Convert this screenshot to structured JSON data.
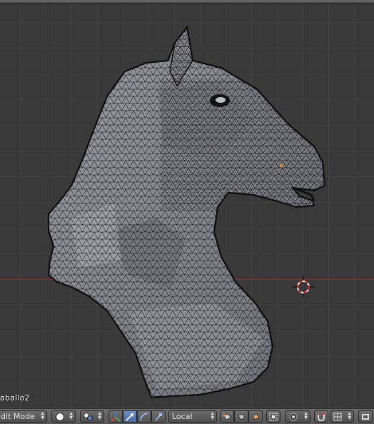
{
  "viewport": {
    "object_name": "aballo2",
    "axis_color": "#8c2a2a",
    "background_color": "#393939"
  },
  "header": {
    "mode_label": "dit Mode",
    "viewport_shading_icon": "solid-sphere-icon",
    "pivot_icon": "pivot-point-icon",
    "manipulator_icons": [
      "manipulator-toggle-icon",
      "translate-icon",
      "rotate-icon",
      "scale-icon"
    ],
    "orientation_label": "Local",
    "select_mode_icons": [
      "vertex-select-icon",
      "edge-select-icon",
      "face-select-icon"
    ],
    "occlude_icon": "occlude-geometry-icon",
    "proportional_icon": "proportional-edit-icon",
    "snap_icons": [
      "snap-magnet-icon",
      "snap-element-icon"
    ],
    "render_icon": "render-icon",
    "accent_color": "#5a7ab4"
  }
}
